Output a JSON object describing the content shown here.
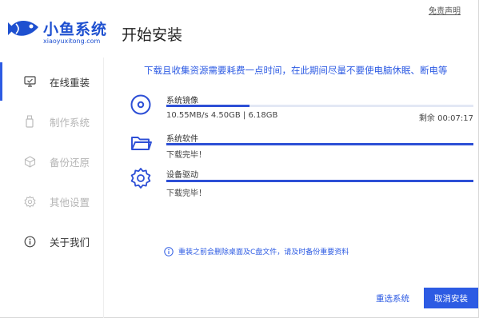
{
  "app": {
    "logo_title": "小鱼系统",
    "logo_subtitle": "xiaoyuxitong.com",
    "disclaimer": "免责声明",
    "page_title": "开始安装"
  },
  "sidebar": {
    "items": [
      {
        "label": "在线重装",
        "icon": "monitor-icon",
        "state": "active"
      },
      {
        "label": "制作系统",
        "icon": "usb-drive-icon",
        "state": "disabled"
      },
      {
        "label": "备份还原",
        "icon": "backup-cube-icon",
        "state": "disabled"
      },
      {
        "label": "其他设置",
        "icon": "gear-icon",
        "state": "disabled"
      },
      {
        "label": "关于我们",
        "icon": "info-icon",
        "state": "normal"
      }
    ]
  },
  "main": {
    "notice": "下载且收集资源需要耗费一点时间，在此期间尽量不要使电脑休眠、断电等",
    "tasks": [
      {
        "name": "系统镜像",
        "icon": "disc-icon",
        "status": "10.55MB/s 4.50GB | 6.18GB",
        "remaining": "剩余 00:07:17",
        "progress": 0.27
      },
      {
        "name": "系统软件",
        "icon": "folder-icon",
        "status": "下载完毕！",
        "progress": 1.0
      },
      {
        "name": "设备驱动",
        "icon": "gear-icon",
        "status": "下载完毕！",
        "progress": 1.0
      }
    ],
    "warning": "重装之前会删除桌面及C盘文件，请及时备份重要资料"
  },
  "footer": {
    "reselect_label": "重选系统",
    "cancel_label": "取消安装"
  },
  "colors": {
    "accent": "#2d5be3",
    "progress": "#2d4fd6",
    "track": "#e3e8f5"
  }
}
